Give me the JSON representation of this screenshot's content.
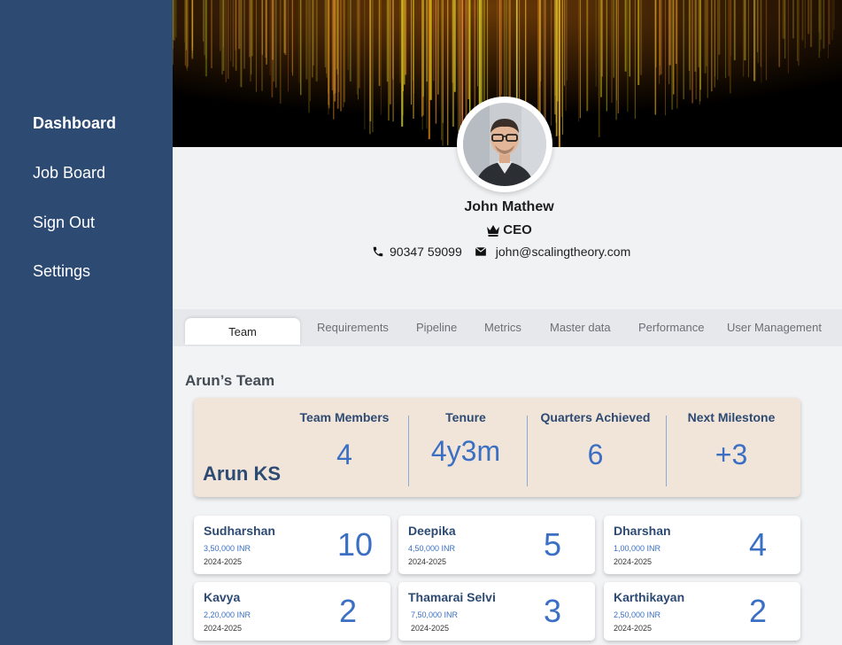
{
  "sidebar": {
    "items": [
      {
        "label": "Dashboard",
        "active": true
      },
      {
        "label": "Job Board"
      },
      {
        "label": "Sign Out"
      },
      {
        "label": "Settings"
      }
    ]
  },
  "profile": {
    "name": "John Mathew",
    "role": "CEO",
    "role_icon": "crown-icon",
    "phone": "90347 59099",
    "email": "john@scalingtheory.com"
  },
  "tabs": [
    {
      "label": "Team",
      "active": true
    },
    {
      "label": "Requirements"
    },
    {
      "label": "Pipeline"
    },
    {
      "label": "Metrics"
    },
    {
      "label": "Master data"
    },
    {
      "label": "Performance"
    },
    {
      "label": "User Management"
    }
  ],
  "team": {
    "title": "Arun’s Team",
    "summary": {
      "name": "Arun KS",
      "stats": [
        {
          "label": "Team Members",
          "value": "4"
        },
        {
          "label": "Tenure",
          "value": "4y3m"
        },
        {
          "label": "Quarters Achieved",
          "value": "6"
        },
        {
          "label": "Next Milestone",
          "value": "+3"
        }
      ]
    },
    "members": [
      {
        "name": "Sudharshan",
        "salary": "3,50,000 INR",
        "year": "2024-2025",
        "count": "10"
      },
      {
        "name": "Deepika",
        "salary": "4,50,000 INR",
        "year": "2024-2025",
        "count": "5"
      },
      {
        "name": "Dharshan",
        "salary": "1,00,000 INR",
        "year": "2024-2025",
        "count": "4"
      },
      {
        "name": "Kavya",
        "salary": "2,20,000 INR",
        "year": "2024-2025",
        "count": "2"
      },
      {
        "name": "Thamarai Selvi",
        "salary": "7,50,000 INR",
        "year": "2024-2025",
        "count": "3"
      },
      {
        "name": "Karthikayan",
        "salary": "2,50,000 INR",
        "year": "2024-2025",
        "count": "2"
      }
    ]
  },
  "colors": {
    "sidebar": "#2d4a72",
    "accent": "#3a6fc4",
    "summary_bg": "#f1e4d8",
    "banner_glow": "#e08a1e"
  }
}
